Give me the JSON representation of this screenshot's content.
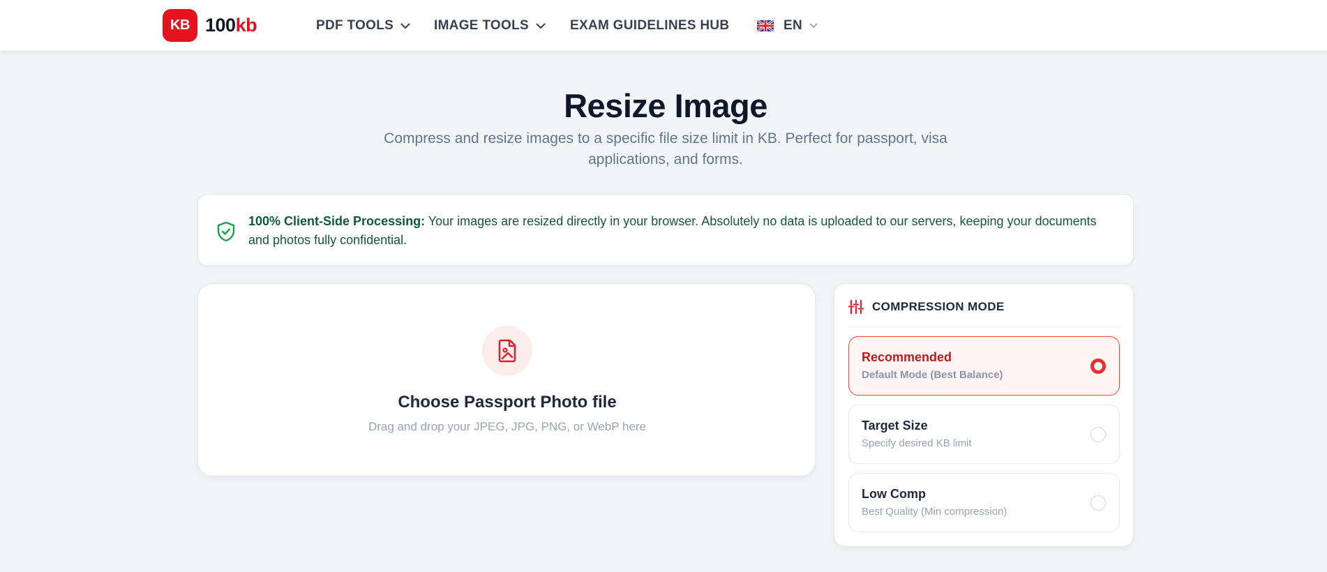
{
  "header": {
    "logo_badge": "KB",
    "logo_num": "100",
    "logo_kb": "kb",
    "nav": {
      "pdf_tools": "PDF TOOLS",
      "image_tools": "IMAGE TOOLS",
      "exam_hub": "EXAM GUIDELINES HUB",
      "language": "EN"
    }
  },
  "main": {
    "title": "Resize Image",
    "subtitle": "Compress and resize images to a specific file size limit in KB. Perfect for passport, visa applications, and forms."
  },
  "notice": {
    "icon": "shield-check-icon",
    "bold": "100% Client-Side Processing:",
    "text": " Your images are resized directly in your browser. Absolutely no data is uploaded to our servers, keeping your documents and photos fully confidential."
  },
  "upload": {
    "icon": "file-image-icon",
    "title": "Choose Passport Photo file",
    "hint": "Drag and drop your JPEG, JPG, PNG, or WebP here"
  },
  "compression": {
    "heading": "COMPRESSION MODE",
    "icon": "sliders-icon",
    "options": [
      {
        "title": "Recommended",
        "subtitle": "Default Mode (Best Balance)",
        "selected": true
      },
      {
        "title": "Target Size",
        "subtitle": "Specify desired KB limit",
        "selected": false
      },
      {
        "title": "Low Comp",
        "subtitle": "Best Quality (Min compression)",
        "selected": false
      }
    ]
  },
  "colors": {
    "brand": "#e5121f",
    "background": "#f2f5f8",
    "notice_text": "#14573a",
    "selected_border": "#ef4444"
  }
}
